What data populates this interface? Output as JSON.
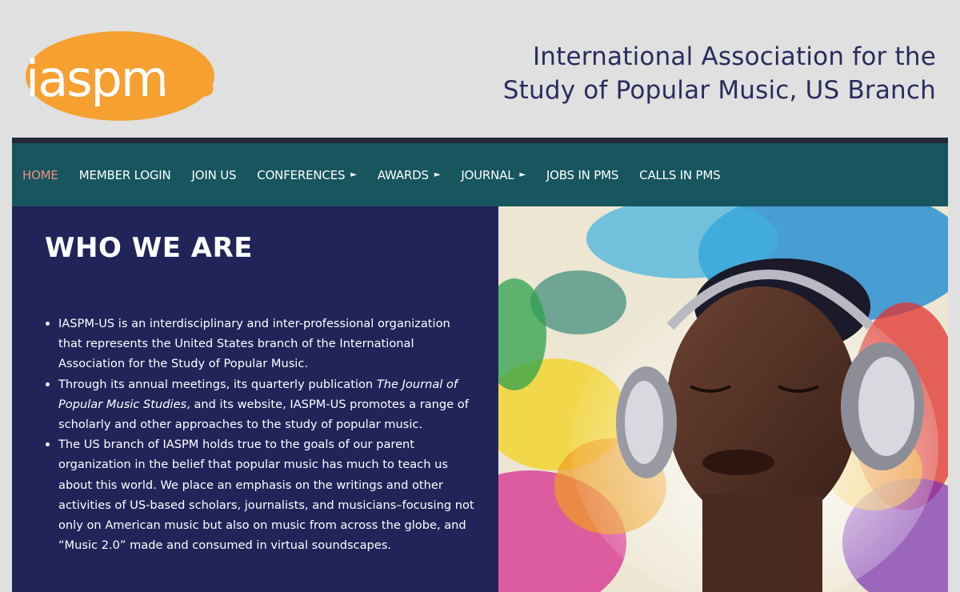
{
  "header": {
    "logo_text": "iaspmus",
    "title_line1": "International Association for the",
    "title_line2": "Study of Popular Music, US Branch"
  },
  "nav": {
    "items": [
      {
        "label": "HOME",
        "active": true,
        "has_submenu": false
      },
      {
        "label": "MEMBER LOGIN",
        "active": false,
        "has_submenu": false
      },
      {
        "label": "JOIN US",
        "active": false,
        "has_submenu": false
      },
      {
        "label": "CONFERENCES",
        "active": false,
        "has_submenu": true
      },
      {
        "label": "AWARDS",
        "active": false,
        "has_submenu": true
      },
      {
        "label": "JOURNAL",
        "active": false,
        "has_submenu": true
      },
      {
        "label": "JOBS IN PMS",
        "active": false,
        "has_submenu": false
      },
      {
        "label": "CALLS IN PMS",
        "active": false,
        "has_submenu": false
      }
    ],
    "submenu_indicator": "►"
  },
  "main": {
    "heading": "WHO WE ARE",
    "bullets": {
      "b1": "IASPM-US is an interdisciplinary and inter-professional organization that represents the United States branch of the International Association for the Study of Popular Music.",
      "b2_pre": "Through its annual meetings, its quarterly publication ",
      "b2_journal": "The Journal of Popular Music Studies",
      "b2_post": ", and its website, IASPM-US promotes a range of scholarly and other approaches to the study of popular music.",
      "b3": "The US branch of IASPM holds true to the goals of our parent organization in the belief that popular music has much to teach us about this world. We place an emphasis on the writings and other activities of US-based scholars, journalists, and musicians–focusing not only on American music but also on music from across the globe, and “Music 2.0” made and consumed in virtual soundscapes."
    }
  },
  "colors": {
    "logo_orange": "#f5a031",
    "title_navy": "#2a2c5e",
    "nav_teal": "#17555f",
    "nav_active": "#f28e7e",
    "content_navy": "#202458"
  },
  "hero_image": {
    "icon": "person-with-headphones-illustration"
  }
}
